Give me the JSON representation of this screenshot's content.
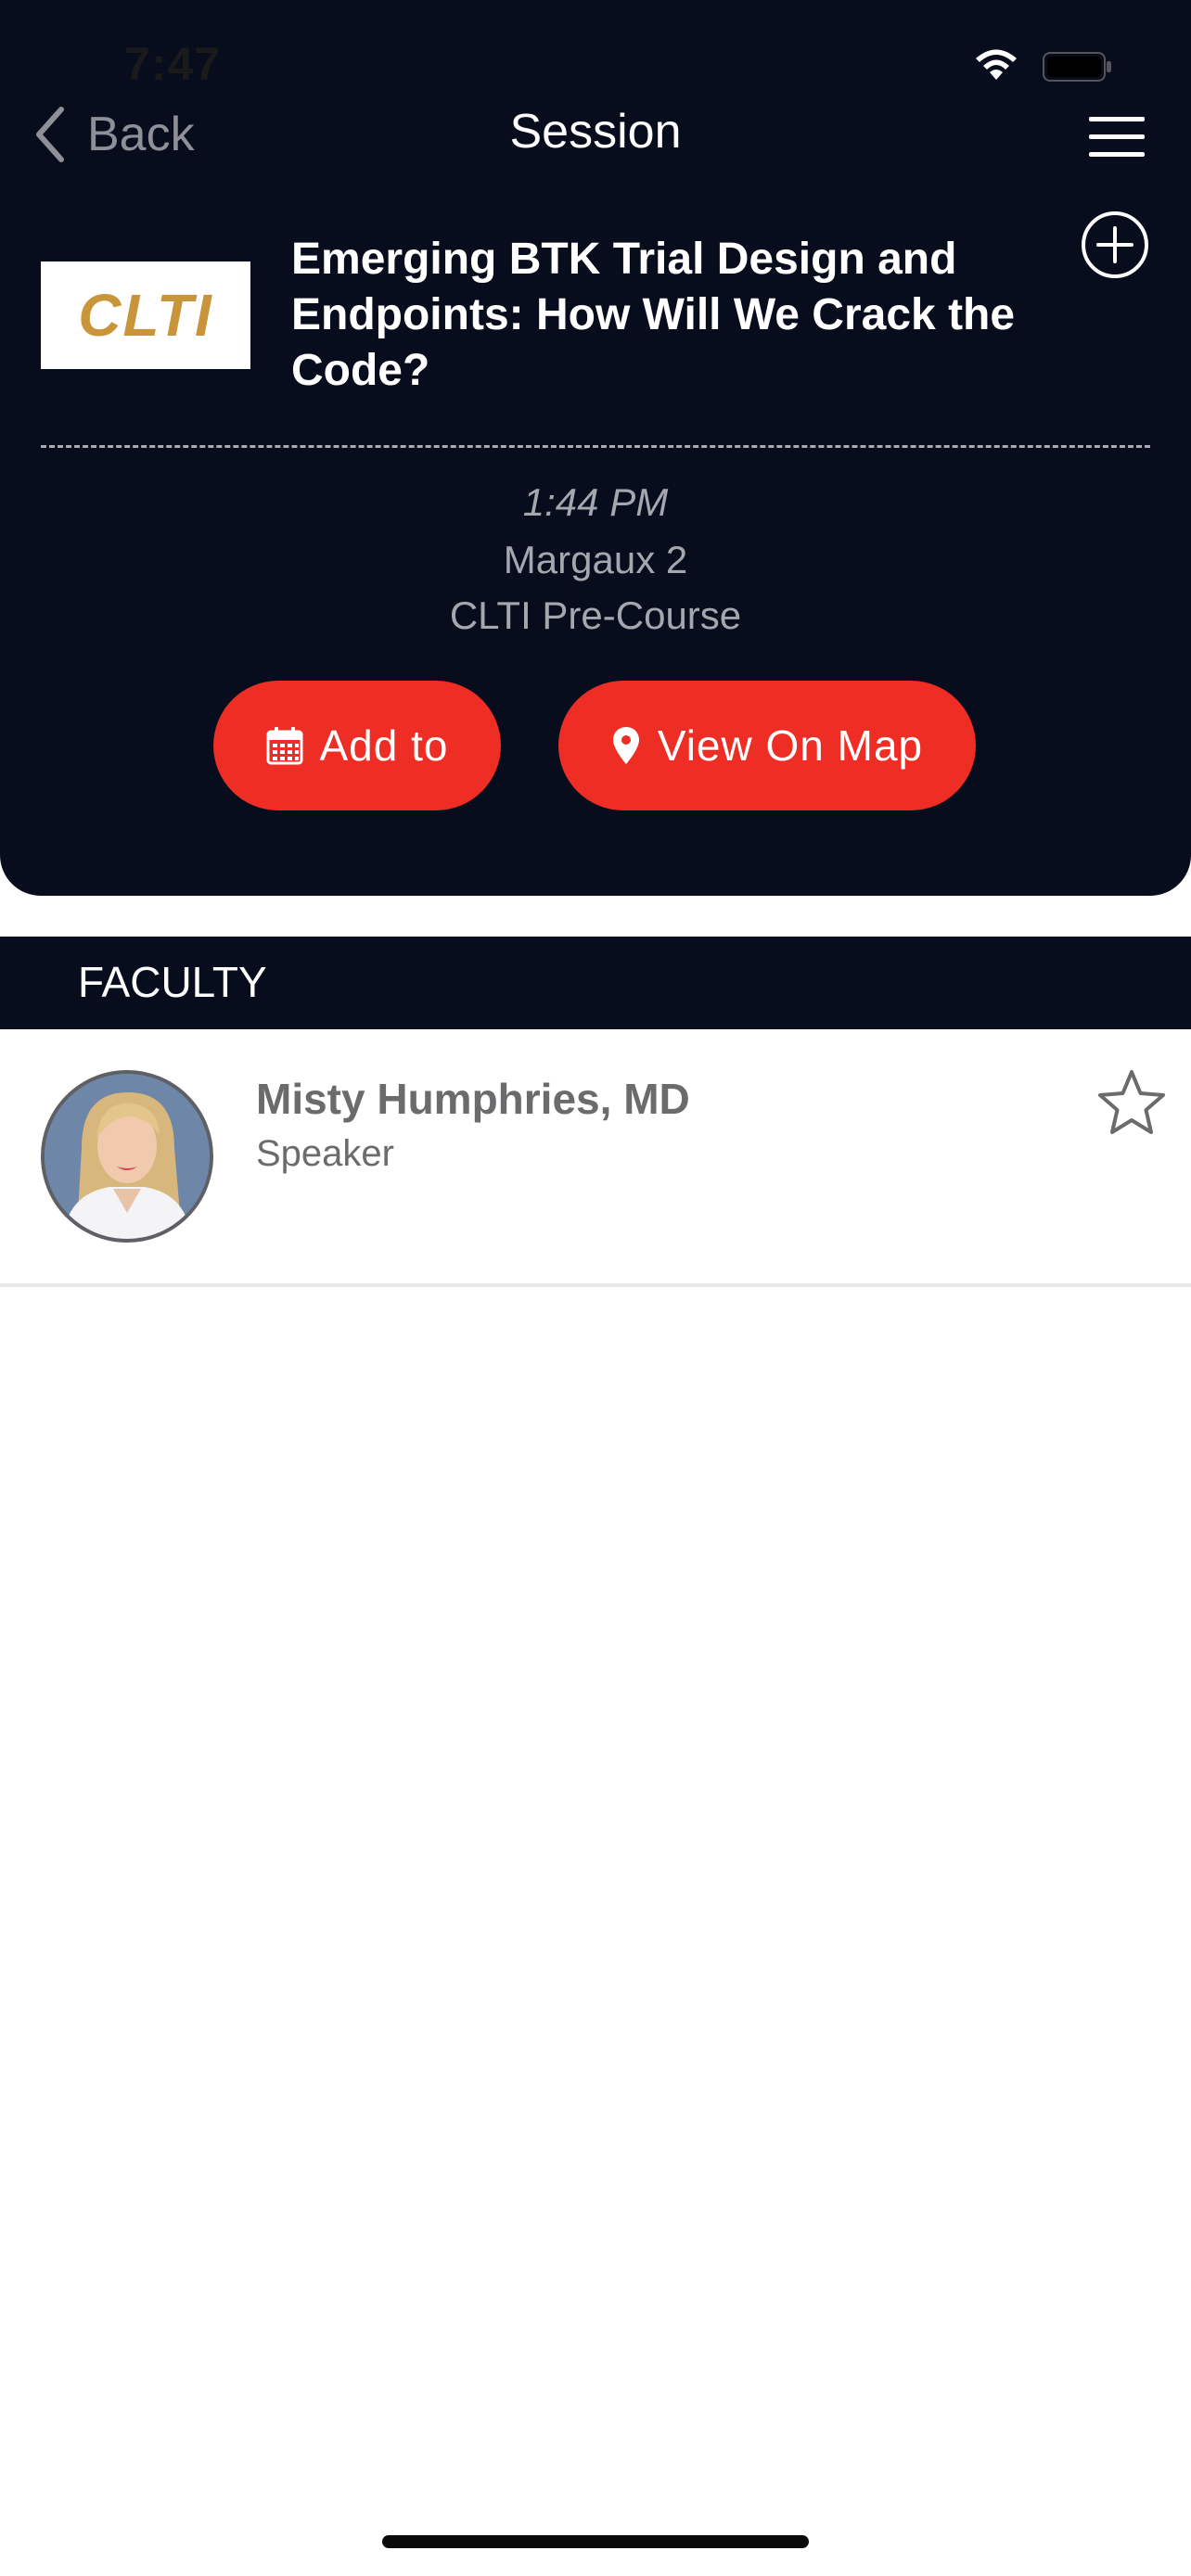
{
  "status_bar": {
    "time": "7:47"
  },
  "nav": {
    "back_label": "Back",
    "title": "Session"
  },
  "session": {
    "logo_text": "CLTI",
    "title": "Emerging BTK Trial Design and Endpoints: How Will We Crack the Code?",
    "time": "1:44 PM",
    "room": "Margaux 2",
    "track": "CLTI Pre-Course",
    "add_to_label": "Add to",
    "view_map_label": "View On Map"
  },
  "faculty": {
    "section_label": "FACULTY",
    "items": [
      {
        "name": "Misty Humphries, MD",
        "role": "Speaker"
      }
    ]
  },
  "colors": {
    "header_bg": "#080d1e",
    "accent_red": "#ee2d24",
    "logo_gold": "#c9953a",
    "muted_text": "#a5a7ae"
  },
  "icons": {
    "back": "chevron-left-icon",
    "menu": "hamburger-menu-icon",
    "add": "plus-circle-icon",
    "calendar": "calendar-icon",
    "map": "map-pin-icon",
    "favorite": "star-outline-icon",
    "wifi": "wifi-icon",
    "battery": "battery-icon"
  }
}
